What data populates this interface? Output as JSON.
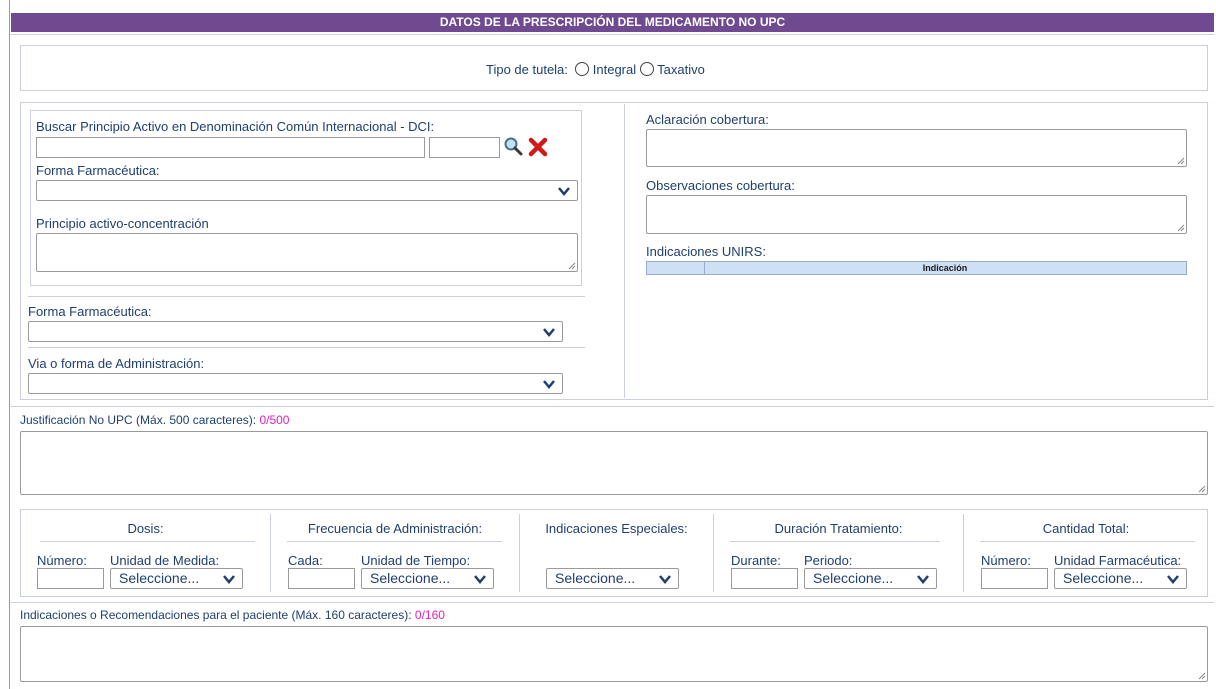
{
  "header": {
    "title": "DATOS DE LA PRESCRIPCIÓN DEL MEDICAMENTO NO UPC"
  },
  "tutela": {
    "label": "Tipo de tutela:",
    "options": [
      "Integral",
      "Taxativo"
    ]
  },
  "dci": {
    "label": "Buscar Principio Activo en Denominación Común Internacional - DCI:",
    "search_value": "",
    "code_value": ""
  },
  "forma_farm_inner": {
    "label": "Forma Farmacéutica:",
    "value": ""
  },
  "principio": {
    "label": "Principio activo-concentración",
    "value": ""
  },
  "forma_farm": {
    "label": "Forma Farmacéutica:",
    "value": ""
  },
  "via": {
    "label": "Via o forma de Administración:",
    "value": ""
  },
  "aclaracion": {
    "label": "Aclaración cobertura:",
    "value": ""
  },
  "observaciones": {
    "label": "Observaciones cobertura:",
    "value": ""
  },
  "unirs": {
    "label": "Indicaciones UNIRS:",
    "col_header": "Indicación"
  },
  "justificacion": {
    "label": "Justificación No UPC (Máx. 500 caracteres):",
    "counter": "0/500",
    "value": ""
  },
  "dosis": {
    "title": "Dosis:",
    "numero_label": "Número:",
    "unidad_label": "Unidad de Medida:",
    "unidad_value": "Seleccione..."
  },
  "frecuencia": {
    "title": "Frecuencia de Administración:",
    "cada_label": "Cada:",
    "unidad_label": "Unidad de Tiempo:",
    "unidad_value": "Seleccione..."
  },
  "especiales": {
    "title": "Indicaciones Especiales:",
    "value": "Seleccione..."
  },
  "duracion": {
    "title": "Duración Tratamiento:",
    "durante_label": "Durante:",
    "periodo_label": "Periodo:",
    "periodo_value": "Seleccione..."
  },
  "cantidad": {
    "title": "Cantidad Total:",
    "numero_label": "Número:",
    "unidad_label": "Unidad Farmacéutica:",
    "unidad_value": "Seleccione..."
  },
  "paciente": {
    "label": "Indicaciones o Recomendaciones para el paciente (Máx. 160 caracteres):",
    "counter": "0/160",
    "value": ""
  },
  "colors": {
    "header_bg": "#6f4a90",
    "label": "#1f3f6e",
    "counter": "#e020c0",
    "border": "#c9cfe0"
  },
  "icons": [
    "search-icon",
    "delete-icon",
    "chevron-down-icon",
    "resize-grip-icon"
  ]
}
